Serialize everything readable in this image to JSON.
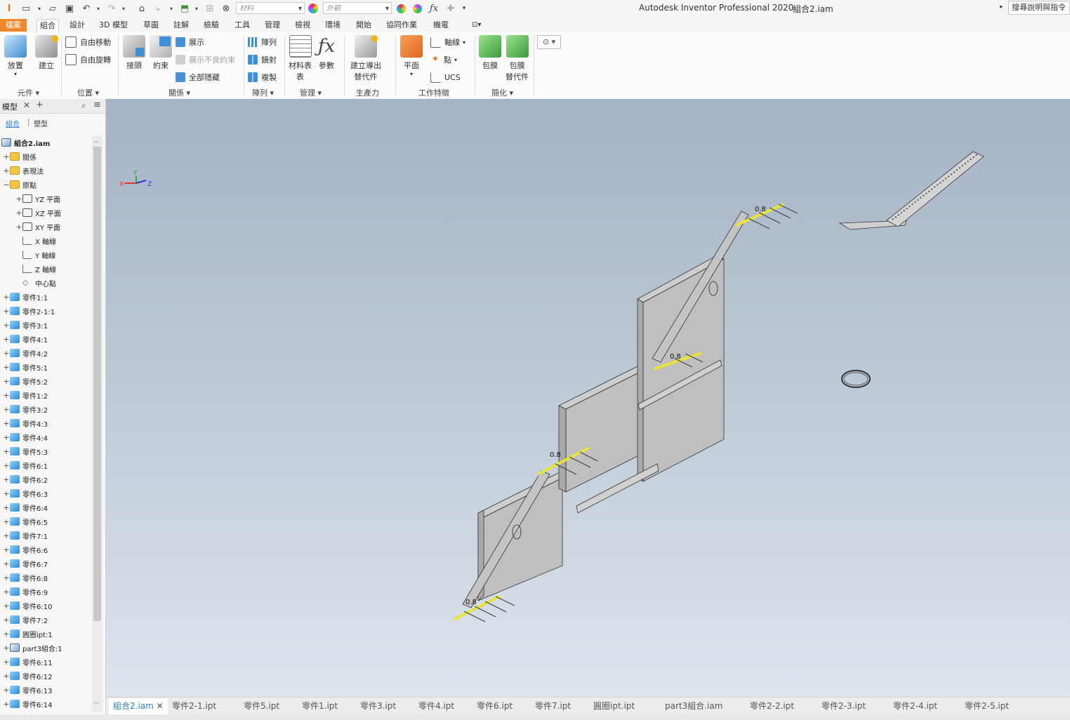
{
  "titlebar": {
    "app_title": "Autodesk Inventor Professional 2020",
    "doc_title": "組合2.iam",
    "material_placeholder": "材料",
    "appearance_placeholder": "外觀",
    "help_search": "搜尋說明與指令"
  },
  "ribbon_tabs": [
    "檔案",
    "組合",
    "設計",
    "3D 模型",
    "草圖",
    "註解",
    "檢驗",
    "工具",
    "管理",
    "檢視",
    "環境",
    "開始",
    "協同作業",
    "機電"
  ],
  "ribbon": {
    "component": {
      "place": "放置",
      "create": "建立",
      "label": "元件"
    },
    "position": {
      "free_move": "自由移動",
      "free_rotate": "自由旋轉",
      "label": "位置"
    },
    "relationships": {
      "joint": "接頭",
      "constrain": "約束",
      "show": "展示",
      "show_sick": "展示不良約束",
      "hide_all": "全部隱藏",
      "label": "關係"
    },
    "pattern": {
      "pattern": "陣列",
      "mirror": "鏡射",
      "copy": "複製",
      "label": "陣列"
    },
    "manage": {
      "bom": "材料表",
      "bom_line2": "表",
      "params": "參數",
      "label": "管理"
    },
    "productivity": {
      "create_sub_line1": "建立導出",
      "create_sub_line2": "替代件",
      "label": "生產力"
    },
    "work_features": {
      "plane": "平面",
      "axis": "軸線",
      "point": "點",
      "ucs": "UCS",
      "label": "工作特徵"
    },
    "simplification": {
      "shrinkwrap": "包膜",
      "shrinkwrap_sub_line1": "包膜",
      "shrinkwrap_sub_line2": "替代件",
      "label": "簡化"
    }
  },
  "browser": {
    "title": "模型",
    "tab_assembly": "組合",
    "tab_modeling": "塑型",
    "root": "組合2.iam",
    "items": [
      {
        "label": "關係",
        "icon": "folder"
      },
      {
        "label": "表現法",
        "icon": "folder"
      },
      {
        "label": "原點",
        "icon": "folder"
      },
      {
        "label": "YZ 平面",
        "icon": "plane"
      },
      {
        "label": "XZ 平面",
        "icon": "plane"
      },
      {
        "label": "XY 平面",
        "icon": "plane"
      },
      {
        "label": "X 軸線",
        "icon": "axis"
      },
      {
        "label": "Y 軸線",
        "icon": "axis"
      },
      {
        "label": "Z 軸線",
        "icon": "axis"
      },
      {
        "label": "中心點",
        "icon": "point"
      },
      {
        "label": "零件1:1",
        "icon": "part"
      },
      {
        "label": "零件2-1:1",
        "icon": "part"
      },
      {
        "label": "零件3:1",
        "icon": "part"
      },
      {
        "label": "零件4:1",
        "icon": "part"
      },
      {
        "label": "零件4:2",
        "icon": "part"
      },
      {
        "label": "零件5:1",
        "icon": "part"
      },
      {
        "label": "零件5:2",
        "icon": "part"
      },
      {
        "label": "零件1:2",
        "icon": "part"
      },
      {
        "label": "零件3:2",
        "icon": "part"
      },
      {
        "label": "零件4:3",
        "icon": "part"
      },
      {
        "label": "零件4:4",
        "icon": "part"
      },
      {
        "label": "零件5:3",
        "icon": "part"
      },
      {
        "label": "零件6:1",
        "icon": "part"
      },
      {
        "label": "零件6:2",
        "icon": "part"
      },
      {
        "label": "零件6:3",
        "icon": "part"
      },
      {
        "label": "零件6:4",
        "icon": "part"
      },
      {
        "label": "零件6:5",
        "icon": "part"
      },
      {
        "label": "零件7:1",
        "icon": "part"
      },
      {
        "label": "零件6:6",
        "icon": "part"
      },
      {
        "label": "零件6:7",
        "icon": "part"
      },
      {
        "label": "零件6:8",
        "icon": "part"
      },
      {
        "label": "零件6:9",
        "icon": "part"
      },
      {
        "label": "零件6:10",
        "icon": "part"
      },
      {
        "label": "零件7:2",
        "icon": "part"
      },
      {
        "label": "圓圈ipt:1",
        "icon": "part"
      },
      {
        "label": "part3組合:1",
        "icon": "asm"
      },
      {
        "label": "零件6:11",
        "icon": "part"
      },
      {
        "label": "零件6:12",
        "icon": "part"
      },
      {
        "label": "零件6:13",
        "icon": "part"
      },
      {
        "label": "零件6:14",
        "icon": "part"
      }
    ]
  },
  "viewport": {
    "annotations": [
      "0.8",
      "0.8",
      "0.8",
      "0.8"
    ],
    "triad": {
      "x": "X",
      "y": "Y",
      "z": "Z"
    }
  },
  "doc_tabs": [
    "組合2.iam",
    "零件2-1.ipt",
    "零件5.ipt",
    "零件1.ipt",
    "零件3.ipt",
    "零件4.ipt",
    "零件6.ipt",
    "零件7.ipt",
    "圓圈ipt.ipt",
    "part3組合.iam",
    "零件2-2.ipt",
    "零件2-3.ipt",
    "零件2-4.ipt",
    "零件2-5.ipt"
  ]
}
